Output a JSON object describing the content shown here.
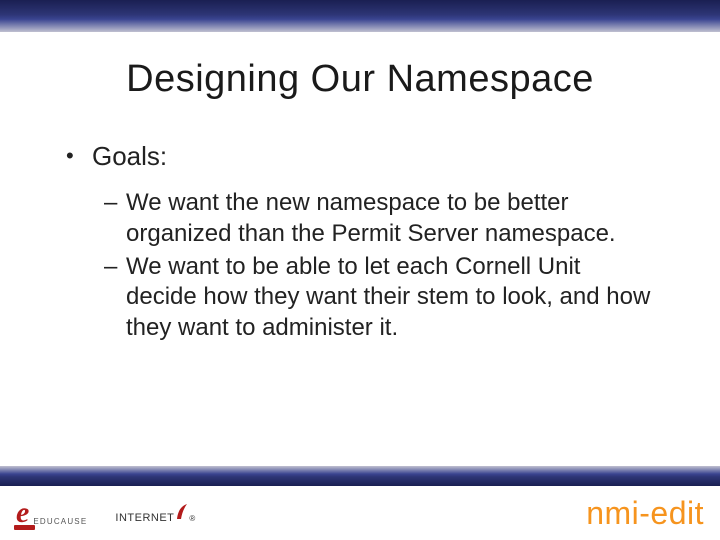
{
  "title": "Designing Our Namespace",
  "bullets": {
    "heading": "Goals:",
    "items": [
      "We want the new namespace to be better organized than the Permit Server namespace.",
      "We want to be able to let each Cornell Unit decide how they want their stem to look, and how they want to administer it."
    ]
  },
  "footer": {
    "educause_label": "EDUCAUSE",
    "internet2_label": "INTERNET",
    "nmi_part1": "nmi",
    "nmi_part2": "edit"
  }
}
